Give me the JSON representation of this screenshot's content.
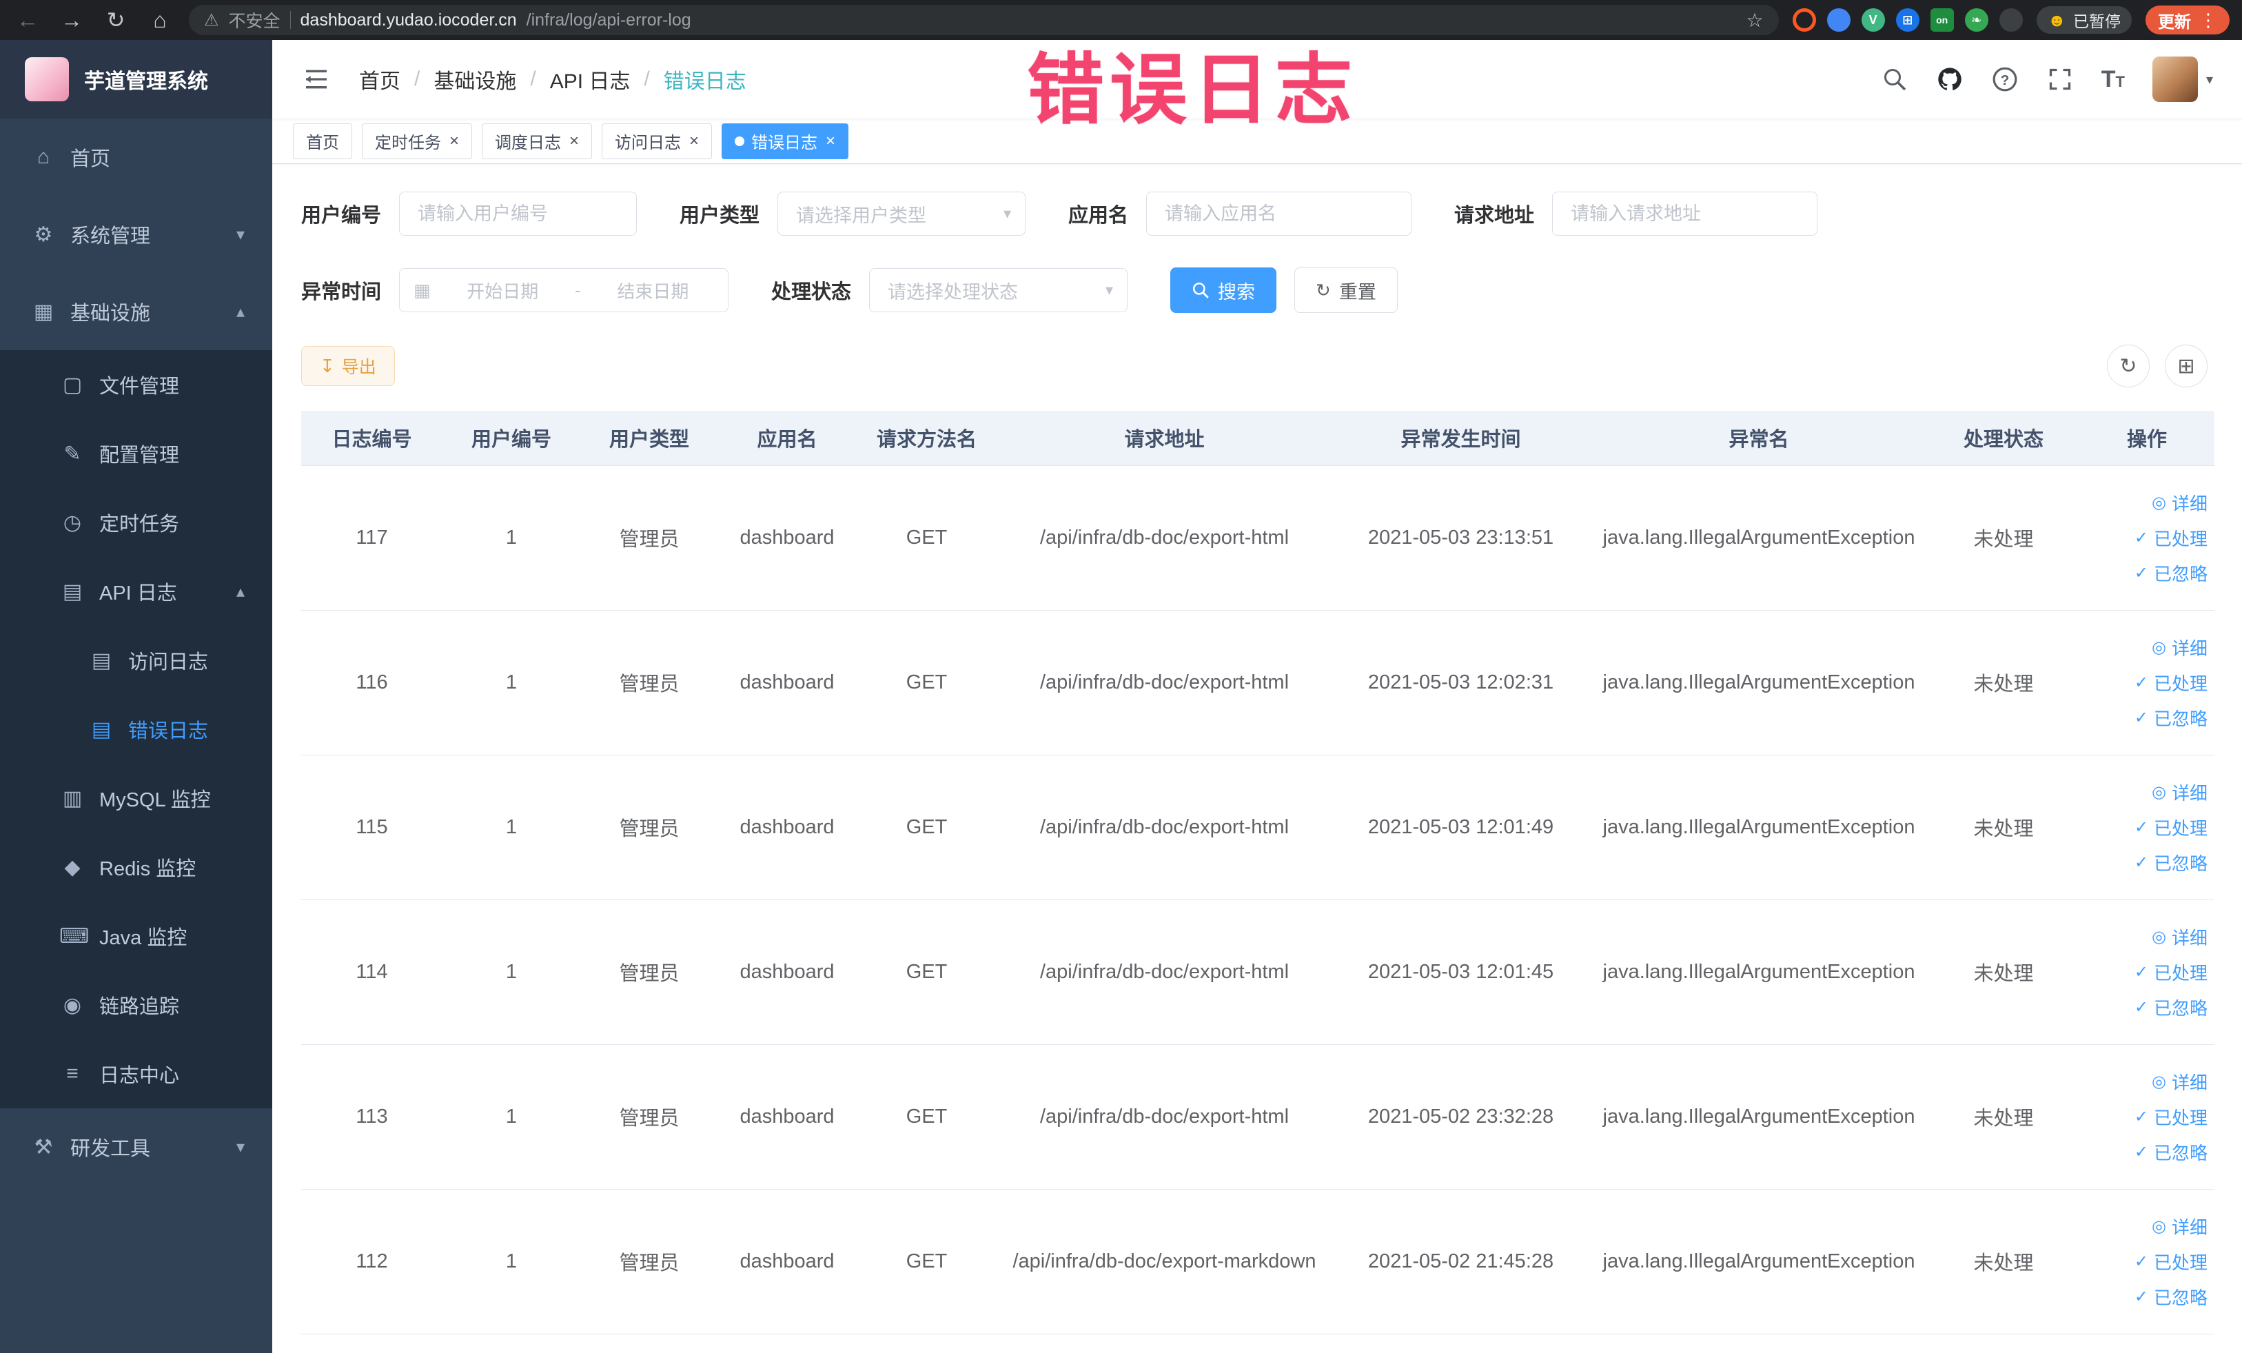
{
  "browser": {
    "security_label": "不安全",
    "url_domain": "dashboard.yudao.iocoder.cn",
    "url_path": "/infra/log/api-error-log",
    "ext_badge_on": "on",
    "paused_badge": "已暂停",
    "update_button": "更新"
  },
  "annotation": {
    "text": "错误日志",
    "color": "#f2446e"
  },
  "sidebar": {
    "logo_title": "芋道管理系统",
    "menu": [
      {
        "label": "首页",
        "icon": "home",
        "glyph": "⌂",
        "level": 1
      },
      {
        "label": "系统管理",
        "icon": "gear",
        "glyph": "⚙",
        "level": 1,
        "arrow": "down"
      },
      {
        "label": "基础设施",
        "icon": "infrastructure",
        "glyph": "▦",
        "level": 1,
        "arrow": "up"
      },
      {
        "label": "文件管理",
        "icon": "file",
        "glyph": "▢",
        "level": 2
      },
      {
        "label": "配置管理",
        "icon": "edit",
        "glyph": "✎",
        "level": 2
      },
      {
        "label": "定时任务",
        "icon": "timer",
        "glyph": "◷",
        "level": 2
      },
      {
        "label": "API 日志",
        "icon": "api-log",
        "glyph": "▤",
        "level": 2,
        "arrow": "up"
      },
      {
        "label": "访问日志",
        "icon": "access-log",
        "glyph": "▤",
        "level": 3
      },
      {
        "label": "错误日志",
        "icon": "error-log",
        "glyph": "▤",
        "level": 3,
        "active": true
      },
      {
        "label": "MySQL 监控",
        "icon": "mysql",
        "glyph": "▥",
        "level": 2
      },
      {
        "label": "Redis 监控",
        "icon": "redis",
        "glyph": "◆",
        "level": 2
      },
      {
        "label": "Java 监控",
        "icon": "java",
        "glyph": "⌨",
        "level": 2
      },
      {
        "label": "链路追踪",
        "icon": "trace",
        "glyph": "◉",
        "level": 2
      },
      {
        "label": "日志中心",
        "icon": "log-center",
        "glyph": "≡",
        "level": 2
      },
      {
        "label": "研发工具",
        "icon": "dev-tools",
        "glyph": "⚒",
        "level": 1,
        "arrow": "down"
      }
    ]
  },
  "header": {
    "breadcrumb": [
      "首页",
      "基础设施",
      "API 日志",
      "错误日志"
    ],
    "breadcrumb_current_color": "#3eb6c0"
  },
  "tabs": [
    {
      "label": "首页",
      "closable": false,
      "active": false
    },
    {
      "label": "定时任务",
      "closable": true,
      "active": false
    },
    {
      "label": "调度日志",
      "closable": true,
      "active": false
    },
    {
      "label": "访问日志",
      "closable": true,
      "active": false
    },
    {
      "label": "错误日志",
      "closable": true,
      "active": true
    }
  ],
  "filters": {
    "user_id": {
      "label": "用户编号",
      "placeholder": "请输入用户编号"
    },
    "user_type": {
      "label": "用户类型",
      "placeholder": "请选择用户类型"
    },
    "app_name": {
      "label": "应用名",
      "placeholder": "请输入应用名"
    },
    "request_url": {
      "label": "请求地址",
      "placeholder": "请输入请求地址"
    },
    "exception_time": {
      "label": "异常时间",
      "start_placeholder": "开始日期",
      "separator": "-",
      "end_placeholder": "结束日期"
    },
    "process_status": {
      "label": "处理状态",
      "placeholder": "请选择处理状态"
    },
    "search_button": "搜索",
    "reset_button": "重置"
  },
  "toolbar": {
    "export_button": "导出"
  },
  "table": {
    "columns": [
      "日志编号",
      "用户编号",
      "用户类型",
      "应用名",
      "请求方法名",
      "请求地址",
      "异常发生时间",
      "异常名",
      "处理状态",
      "操作"
    ],
    "rows": [
      {
        "log_id": "117",
        "user_id": "1",
        "user_type": "管理员",
        "app_name": "dashboard",
        "method": "GET",
        "url": "/api/infra/db-doc/export-html",
        "time": "2021-05-03 23:13:51",
        "exception": "java.lang.IllegalArgumentException",
        "status": "未处理"
      },
      {
        "log_id": "116",
        "user_id": "1",
        "user_type": "管理员",
        "app_name": "dashboard",
        "method": "GET",
        "url": "/api/infra/db-doc/export-html",
        "time": "2021-05-03 12:02:31",
        "exception": "java.lang.IllegalArgumentException",
        "status": "未处理"
      },
      {
        "log_id": "115",
        "user_id": "1",
        "user_type": "管理员",
        "app_name": "dashboard",
        "method": "GET",
        "url": "/api/infra/db-doc/export-html",
        "time": "2021-05-03 12:01:49",
        "exception": "java.lang.IllegalArgumentException",
        "status": "未处理"
      },
      {
        "log_id": "114",
        "user_id": "1",
        "user_type": "管理员",
        "app_name": "dashboard",
        "method": "GET",
        "url": "/api/infra/db-doc/export-html",
        "time": "2021-05-03 12:01:45",
        "exception": "java.lang.IllegalArgumentException",
        "status": "未处理"
      },
      {
        "log_id": "113",
        "user_id": "1",
        "user_type": "管理员",
        "app_name": "dashboard",
        "method": "GET",
        "url": "/api/infra/db-doc/export-html",
        "time": "2021-05-02 23:32:28",
        "exception": "java.lang.IllegalArgumentException",
        "status": "未处理"
      },
      {
        "log_id": "112",
        "user_id": "1",
        "user_type": "管理员",
        "app_name": "dashboard",
        "method": "GET",
        "url": "/api/infra/db-doc/export-markdown",
        "time": "2021-05-02 21:45:28",
        "exception": "java.lang.IllegalArgumentException",
        "status": "未处理"
      }
    ],
    "actions": {
      "detail": "详细",
      "processed": "已处理",
      "ignored": "已忽略",
      "detail_icon": "◎",
      "check_icon": "✓"
    }
  },
  "colors": {
    "primary": "#409eff",
    "warning": "#e6a23c",
    "sidebar_bg": "#304156",
    "submenu_bg": "#1f2d3d",
    "table_header_bg": "#eef3f9"
  }
}
